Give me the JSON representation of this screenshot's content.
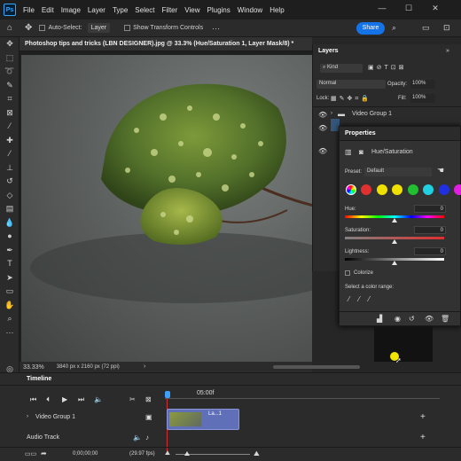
{
  "menubar": {
    "app_icon": "Ps",
    "items": [
      "File",
      "Edit",
      "Image",
      "Layer",
      "Type",
      "Select",
      "Filter",
      "View",
      "Plugins",
      "Window",
      "Help"
    ]
  },
  "options": {
    "auto_select_label": "Auto-Select:",
    "auto_select_value": "Layer",
    "transform_label": "Show Transform Controls",
    "share_label": "Share"
  },
  "document": {
    "tab_title": "Photoshop tips and tricks (LBN DESIGNER).jpg @ 33.3% (Hue/Saturation 1, Layer Mask/8) *",
    "zoom": "33.33%",
    "info": "3840 px x 2160 px (72 ppi)"
  },
  "layers": {
    "tab": "Layers",
    "kind_label": "Kind",
    "blend_mode": "Normal",
    "opacity_label": "Opacity:",
    "opacity_value": "100%",
    "lock_label": "Lock:",
    "fill_label": "Fill:",
    "fill_value": "100%",
    "group_name": "Video Group 1"
  },
  "properties": {
    "tab": "Properties",
    "adjustment_name": "Hue/Saturation",
    "preset_label": "Preset:",
    "preset_value": "Default",
    "hue_label": "Hue:",
    "hue_value": "0",
    "saturation_label": "Saturation:",
    "saturation_value": "0",
    "lightness_label": "Lightness:",
    "lightness_value": "0",
    "colorize_label": "Colorize",
    "select_color_range": "Select a color range:",
    "swatch_colors": [
      "#e03030",
      "#f0e000",
      "#f0e000",
      "#20c030",
      "#20d0e0",
      "#2030e0",
      "#e020e0"
    ]
  },
  "timeline": {
    "title": "Timeline",
    "time_marker": "05:00f",
    "track_video": "Video Group 1",
    "track_audio": "Audio Track",
    "clip_label": "La...1",
    "timecode": "0;00;00;00",
    "fps": "(29.97 fps)"
  }
}
